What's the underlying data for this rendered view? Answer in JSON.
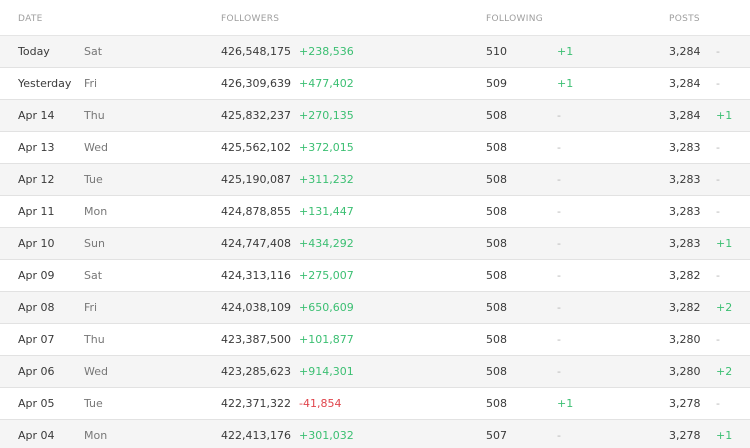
{
  "headers": {
    "date": "DATE",
    "followers": "FOLLOWERS",
    "following": "FOLLOWING",
    "posts": "POSTS"
  },
  "colors": {
    "positive": "#3bbf72",
    "negative": "#e0454c",
    "neutral": "#b5b5b5"
  },
  "rows": [
    {
      "date": "Today",
      "day": "Sat",
      "followers": "426,548,175",
      "followers_delta": "+238,536",
      "following": "510",
      "following_delta": "+1",
      "posts": "3,284",
      "posts_delta": "-"
    },
    {
      "date": "Yesterday",
      "day": "Fri",
      "followers": "426,309,639",
      "followers_delta": "+477,402",
      "following": "509",
      "following_delta": "+1",
      "posts": "3,284",
      "posts_delta": "-"
    },
    {
      "date": "Apr 14",
      "day": "Thu",
      "followers": "425,832,237",
      "followers_delta": "+270,135",
      "following": "508",
      "following_delta": "-",
      "posts": "3,284",
      "posts_delta": "+1"
    },
    {
      "date": "Apr 13",
      "day": "Wed",
      "followers": "425,562,102",
      "followers_delta": "+372,015",
      "following": "508",
      "following_delta": "-",
      "posts": "3,283",
      "posts_delta": "-"
    },
    {
      "date": "Apr 12",
      "day": "Tue",
      "followers": "425,190,087",
      "followers_delta": "+311,232",
      "following": "508",
      "following_delta": "-",
      "posts": "3,283",
      "posts_delta": "-"
    },
    {
      "date": "Apr 11",
      "day": "Mon",
      "followers": "424,878,855",
      "followers_delta": "+131,447",
      "following": "508",
      "following_delta": "-",
      "posts": "3,283",
      "posts_delta": "-"
    },
    {
      "date": "Apr 10",
      "day": "Sun",
      "followers": "424,747,408",
      "followers_delta": "+434,292",
      "following": "508",
      "following_delta": "-",
      "posts": "3,283",
      "posts_delta": "+1"
    },
    {
      "date": "Apr 09",
      "day": "Sat",
      "followers": "424,313,116",
      "followers_delta": "+275,007",
      "following": "508",
      "following_delta": "-",
      "posts": "3,282",
      "posts_delta": "-"
    },
    {
      "date": "Apr 08",
      "day": "Fri",
      "followers": "424,038,109",
      "followers_delta": "+650,609",
      "following": "508",
      "following_delta": "-",
      "posts": "3,282",
      "posts_delta": "+2"
    },
    {
      "date": "Apr 07",
      "day": "Thu",
      "followers": "423,387,500",
      "followers_delta": "+101,877",
      "following": "508",
      "following_delta": "-",
      "posts": "3,280",
      "posts_delta": "-"
    },
    {
      "date": "Apr 06",
      "day": "Wed",
      "followers": "423,285,623",
      "followers_delta": "+914,301",
      "following": "508",
      "following_delta": "-",
      "posts": "3,280",
      "posts_delta": "+2"
    },
    {
      "date": "Apr 05",
      "day": "Tue",
      "followers": "422,371,322",
      "followers_delta": "-41,854",
      "following": "508",
      "following_delta": "+1",
      "posts": "3,278",
      "posts_delta": "-"
    },
    {
      "date": "Apr 04",
      "day": "Mon",
      "followers": "422,413,176",
      "followers_delta": "+301,032",
      "following": "507",
      "following_delta": "-",
      "posts": "3,278",
      "posts_delta": "+1"
    }
  ]
}
